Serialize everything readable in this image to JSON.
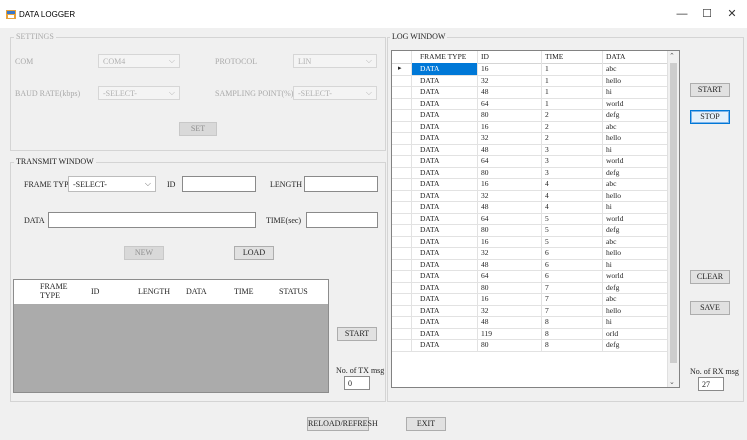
{
  "window": {
    "title": "DATA LOGGER",
    "minimize": "—",
    "maximize": "☐",
    "close": "✕"
  },
  "settings": {
    "title": "SETTINGS",
    "com_label": "COM",
    "com_value": "COM4",
    "protocol_label": "PROTOCOL",
    "protocol_value": "LIN",
    "baud_label": "BAUD RATE(kbps)",
    "baud_value": "-SELECT-",
    "sampling_label": "SAMPLING POINT(%)",
    "sampling_value": "-SELECT-",
    "set_label": "SET"
  },
  "transmit": {
    "title": "TRANSMIT WINDOW",
    "frame_type_label": "FRAME TYPE",
    "frame_type_value": "-SELECT-",
    "id_label": "ID",
    "length_label": "LENGTH",
    "data_label": "DATA",
    "time_label": "TIME(sec)",
    "new_label": "NEW",
    "load_label": "LOAD",
    "columns": [
      "FRAME TYPE",
      "ID",
      "LENGTH",
      "DATA",
      "TIME",
      "STATUS"
    ],
    "start_label": "START",
    "tx_count_label": "No. of TX msg",
    "tx_count_value": "0"
  },
  "log": {
    "title": "LOG WINDOW",
    "columns": [
      "FRAME TYPE",
      "ID",
      "TIME",
      "DATA"
    ],
    "rows": [
      [
        "DATA",
        "16",
        "1",
        "abc"
      ],
      [
        "DATA",
        "32",
        "1",
        "hello"
      ],
      [
        "DATA",
        "48",
        "1",
        "hi"
      ],
      [
        "DATA",
        "64",
        "1",
        "world"
      ],
      [
        "DATA",
        "80",
        "2",
        "defg"
      ],
      [
        "DATA",
        "16",
        "2",
        "abc"
      ],
      [
        "DATA",
        "32",
        "2",
        "hello"
      ],
      [
        "DATA",
        "48",
        "3",
        "hi"
      ],
      [
        "DATA",
        "64",
        "3",
        "world"
      ],
      [
        "DATA",
        "80",
        "3",
        "defg"
      ],
      [
        "DATA",
        "16",
        "4",
        "abc"
      ],
      [
        "DATA",
        "32",
        "4",
        "hello"
      ],
      [
        "DATA",
        "48",
        "4",
        "hi"
      ],
      [
        "DATA",
        "64",
        "5",
        "world"
      ],
      [
        "DATA",
        "80",
        "5",
        "defg"
      ],
      [
        "DATA",
        "16",
        "5",
        "abc"
      ],
      [
        "DATA",
        "32",
        "6",
        "hello"
      ],
      [
        "DATA",
        "48",
        "6",
        "hi"
      ],
      [
        "DATA",
        "64",
        "6",
        "world"
      ],
      [
        "DATA",
        "80",
        "7",
        "defg"
      ],
      [
        "DATA",
        "16",
        "7",
        "abc"
      ],
      [
        "DATA",
        "32",
        "7",
        "hello"
      ],
      [
        "DATA",
        "48",
        "8",
        "hi"
      ],
      [
        "DATA",
        "119",
        "8",
        "orld"
      ],
      [
        "DATA",
        "80",
        "8",
        "defg"
      ]
    ]
  },
  "side": {
    "start_label": "START",
    "stop_label": "STOP",
    "clear_label": "CLEAR",
    "save_label": "SAVE",
    "rx_count_label": "No. of RX msg",
    "rx_count_value": "27"
  },
  "bottom": {
    "reload_label": "RELOAD/REFRESH",
    "exit_label": "EXIT"
  }
}
